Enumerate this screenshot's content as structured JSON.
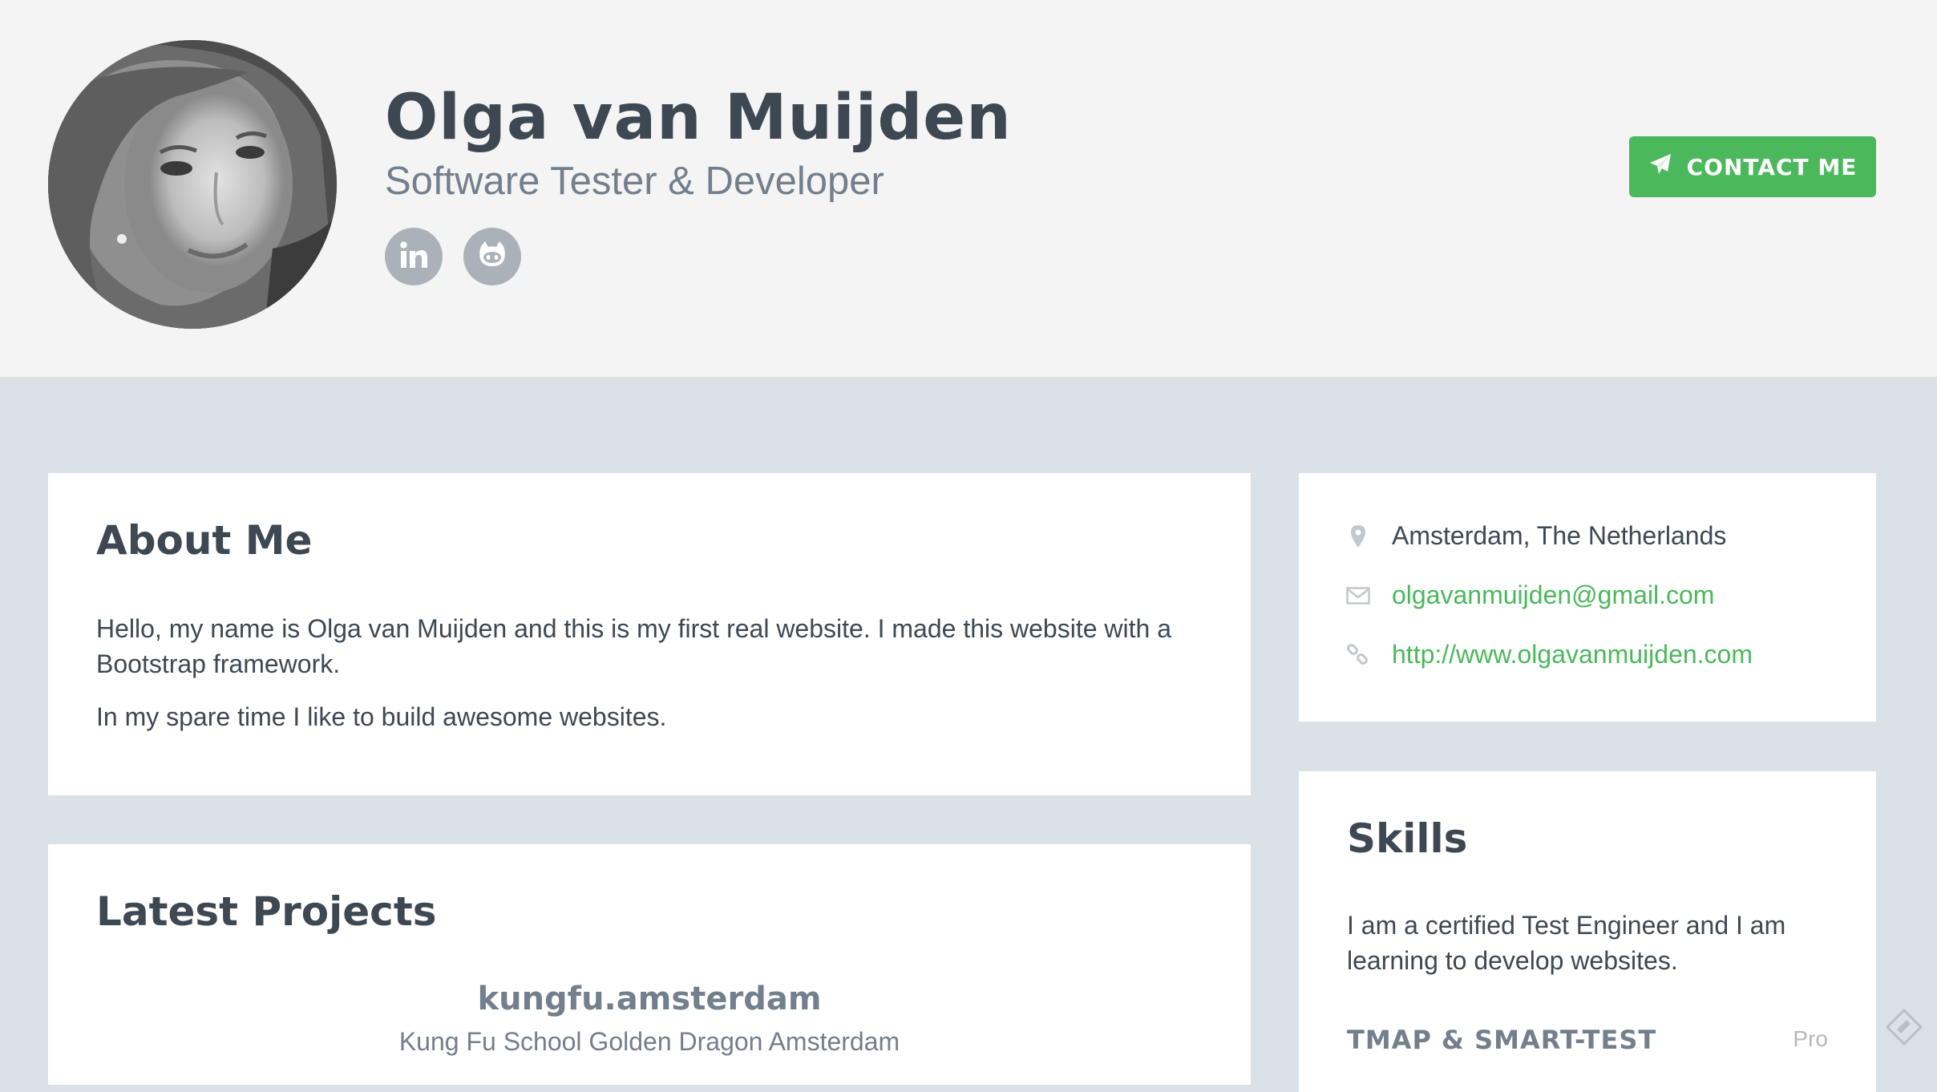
{
  "profile": {
    "name": "Olga van Muijden",
    "tagline": "Software Tester & Developer",
    "contact_button": "CONTACT ME",
    "social": [
      "linkedin-icon",
      "github-icon"
    ]
  },
  "about": {
    "title": "About Me",
    "paragraphs": [
      "Hello, my name is Olga van Muijden and this is my first real website. I made this website with a Bootstrap framework.",
      "In my spare time I like to build awesome websites."
    ]
  },
  "projects": {
    "title": "Latest Projects",
    "items": [
      {
        "title": "kungfu.amsterdam",
        "subtitle": "Kung Fu School Golden Dragon Amsterdam"
      }
    ]
  },
  "contact_info": {
    "location": "Amsterdam, The Netherlands",
    "email": "olgavanmuijden@gmail.com",
    "website": "http://www.olgavanmuijden.com"
  },
  "skills": {
    "title": "Skills",
    "intro": "I am a certified Test Engineer and I am learning to develop websites.",
    "items": [
      {
        "name": "TMAP & SMART-TEST",
        "level": "Pro"
      }
    ]
  },
  "colors": {
    "accent": "#4cb85c",
    "header_bg": "#f4f4f4",
    "page_bg": "#dbe2e7",
    "text": "#3e4852",
    "muted": "#737f8c"
  }
}
